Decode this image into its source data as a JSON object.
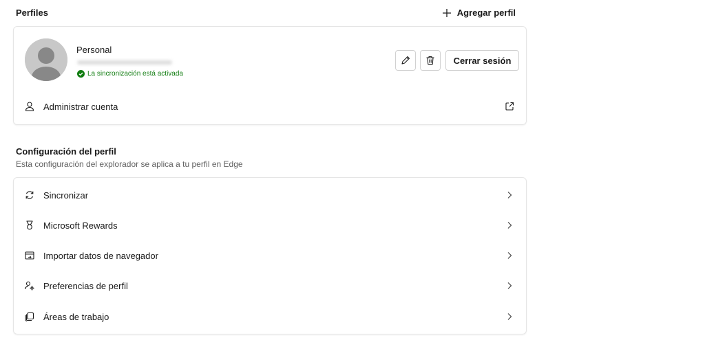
{
  "header": {
    "title": "Perfiles",
    "add_profile_label": "Agregar perfil"
  },
  "profile": {
    "name": "Personal",
    "sync_status": "La sincronización está activada",
    "sign_out_label": "Cerrar sesión",
    "manage_account_label": "Administrar cuenta"
  },
  "settings": {
    "title": "Configuración del perfil",
    "subtitle": "Esta configuración del explorador se aplica a tu perfil en Edge",
    "items": [
      {
        "label": "Sincronizar",
        "icon": "sync-icon"
      },
      {
        "label": "Microsoft Rewards",
        "icon": "rewards-medal-icon"
      },
      {
        "label": "Importar datos de navegador",
        "icon": "import-data-icon"
      },
      {
        "label": "Preferencias de perfil",
        "icon": "profile-preferences-icon"
      },
      {
        "label": "Áreas de trabajo",
        "icon": "workspaces-icon"
      }
    ]
  },
  "colors": {
    "sync_green": "#107c10",
    "border": "#e5e5e5",
    "text": "#1a1a1a",
    "subtle_text": "#616161"
  }
}
